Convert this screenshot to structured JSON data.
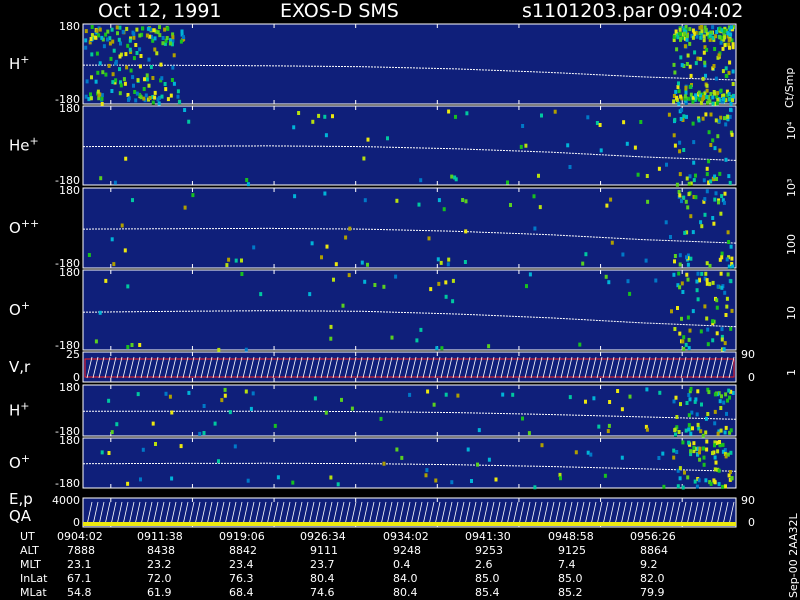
{
  "header": {
    "date": "Oct 12, 1991",
    "instrument": "EXOS-D SMS",
    "file": "s1101203.par",
    "time": "09:04:02"
  },
  "colors": {
    "background": "#000000",
    "panel": "#0f1f7a",
    "text": "#ffffff",
    "velocity_red": "#ff2020"
  },
  "colorbar": {
    "unit_label": "Ct/Smp",
    "ticks": [
      "1",
      "10",
      "100",
      "10³",
      "10⁴"
    ],
    "colors": [
      "#0f1f7a",
      "#1d3fa8",
      "#0079c8",
      "#00b4d8",
      "#00c8a0",
      "#18c020",
      "#5ad020",
      "#b8e010",
      "#ece810",
      "#b0a000",
      "#6a6a00",
      "#8c1010",
      "#ff1010",
      "#b00000",
      "#400000",
      "#ffffff"
    ]
  },
  "rows": {
    "r0": {
      "label": "UT",
      "values": [
        "0904:02",
        "0911:38",
        "0919:06",
        "0926:34",
        "0934:02",
        "0941:30",
        "0948:58",
        "0956:26"
      ]
    },
    "r1": {
      "label": "ALT",
      "values": [
        "7888",
        "8438",
        "8842",
        "9111",
        "9248",
        "9253",
        "9125",
        "8864"
      ]
    },
    "r2": {
      "label": "MLT",
      "values": [
        "23.1",
        "23.2",
        "23.4",
        "23.7",
        "0.4",
        "2.6",
        "7.4",
        "9.2"
      ]
    },
    "r3": {
      "label": "InLat",
      "values": [
        "67.1",
        "72.0",
        "76.3",
        "80.4",
        "84.0",
        "85.0",
        "85.0",
        "82.0"
      ]
    },
    "r4": {
      "label": "MLat",
      "values": [
        "54.8",
        "61.9",
        "68.4",
        "74.6",
        "80.4",
        "85.4",
        "85.2",
        "79.9"
      ]
    }
  },
  "footer_code": "Sep-00  2AA32L",
  "chart_data": {
    "type": "heatmap",
    "x": [
      "0904:02",
      "0911:38",
      "0919:06",
      "0926:34",
      "0934:02",
      "0941:30",
      "0948:58",
      "0956:26"
    ],
    "panels": [
      {
        "label": "H",
        "ion_charge": "+",
        "ytop": "180",
        "ybottom": "-180",
        "ylim": [
          -180,
          180
        ],
        "pitch_trace": [
          -5,
          -6,
          -8,
          -12,
          -22,
          -38,
          -58,
          -72
        ]
      },
      {
        "label": "He",
        "ion_charge": "+",
        "ytop": "180",
        "ybottom": "-180",
        "ylim": [
          -180,
          180
        ],
        "pitch_trace": [
          -5,
          -3,
          -2,
          -5,
          -15,
          -30,
          -52,
          -68
        ]
      },
      {
        "label": "O",
        "ion_charge": "++",
        "ytop": "180",
        "ybottom": "-180",
        "ylim": [
          -180,
          180
        ],
        "pitch_trace": [
          -5,
          -3,
          -2,
          -5,
          -15,
          -30,
          -52,
          -68
        ]
      },
      {
        "label": "O",
        "ion_charge": "+",
        "ytop": "180",
        "ybottom": "-180",
        "ylim": [
          -180,
          180
        ],
        "pitch_trace": [
          -10,
          -6,
          -3,
          -6,
          -18,
          -35,
          -58,
          -75
        ]
      },
      {
        "label": "V,r",
        "ion_charge": "",
        "ytop": "25",
        "ybottom": "0",
        "ylim": [
          0,
          25
        ],
        "right_top": "90",
        "right_bottom": "0"
      },
      {
        "label": "H",
        "ion_charge": "+",
        "ytop": "180",
        "ybottom": "-180",
        "ylim": [
          -180,
          180
        ],
        "pitch_trace": [
          -5,
          -5,
          -5,
          -8,
          -15,
          -28,
          -45,
          -62
        ]
      },
      {
        "label": "O",
        "ion_charge": "+",
        "ytop": "180",
        "ybottom": "-180",
        "ylim": [
          -180,
          180
        ],
        "pitch_trace": [
          -5,
          -3,
          -2,
          -4,
          -12,
          -25,
          -42,
          -60
        ]
      },
      {
        "label": "E,p",
        "label2": "QA",
        "ion_charge": "",
        "ytop": "4000",
        "ybottom": "0",
        "ylim": [
          0,
          4000
        ],
        "right_top": "90",
        "right_bottom": "0"
      }
    ]
  }
}
